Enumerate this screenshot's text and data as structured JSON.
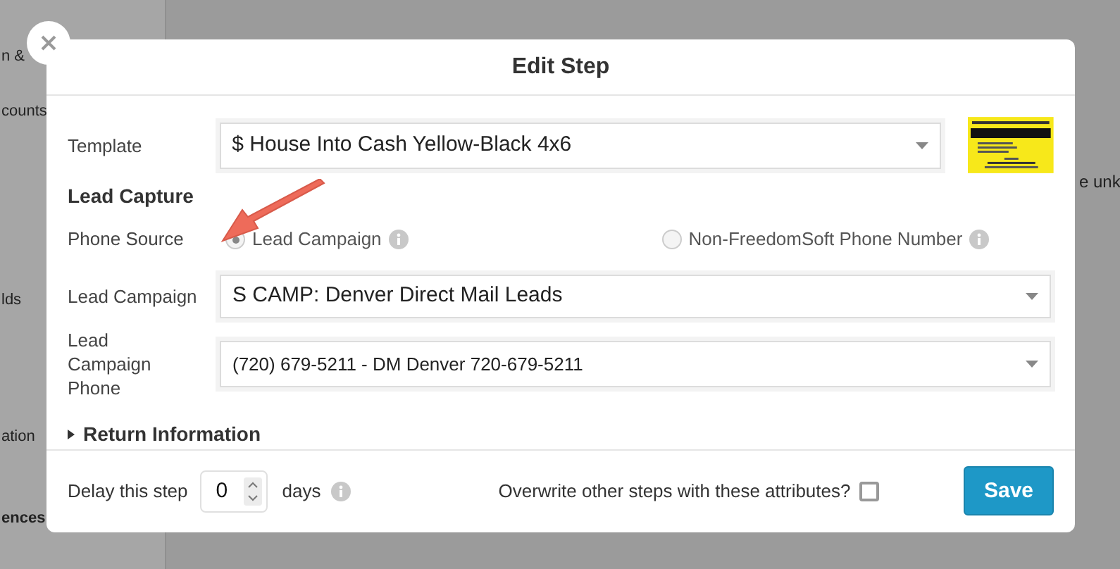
{
  "background": {
    "sidebar_items": [
      {
        "label": "n &",
        "bold": false
      },
      {
        "label": "counts",
        "bold": false
      },
      {
        "label": "lds",
        "bold": false
      },
      {
        "label": "ation",
        "bold": false
      },
      {
        "label": "ences",
        "bold": true
      }
    ],
    "fragment": "e unk"
  },
  "dialog": {
    "title": "Edit Step",
    "template": {
      "label": "Template",
      "value": "$ House Into Cash Yellow-Black 4x6"
    },
    "lead_capture": {
      "heading": "Lead Capture",
      "phone_source": {
        "label": "Phone Source",
        "options": [
          {
            "label": "Lead Campaign",
            "selected": true
          },
          {
            "label": "Non-FreedomSoft Phone Number",
            "selected": false
          }
        ]
      },
      "lead_campaign": {
        "label": "Lead Campaign",
        "value": "S CAMP: Denver Direct Mail Leads"
      },
      "lead_campaign_phone": {
        "label": "Lead Campaign Phone",
        "value": "(720) 679-5211 - DM Denver 720-679-5211"
      }
    },
    "return_information": {
      "label": "Return Information",
      "expanded": false
    },
    "footer": {
      "delay_label": "Delay this step",
      "delay_value": "0",
      "delay_unit": "days",
      "overwrite_label": "Overwrite other steps with these attributes?",
      "overwrite_checked": false,
      "save": "Save"
    }
  }
}
